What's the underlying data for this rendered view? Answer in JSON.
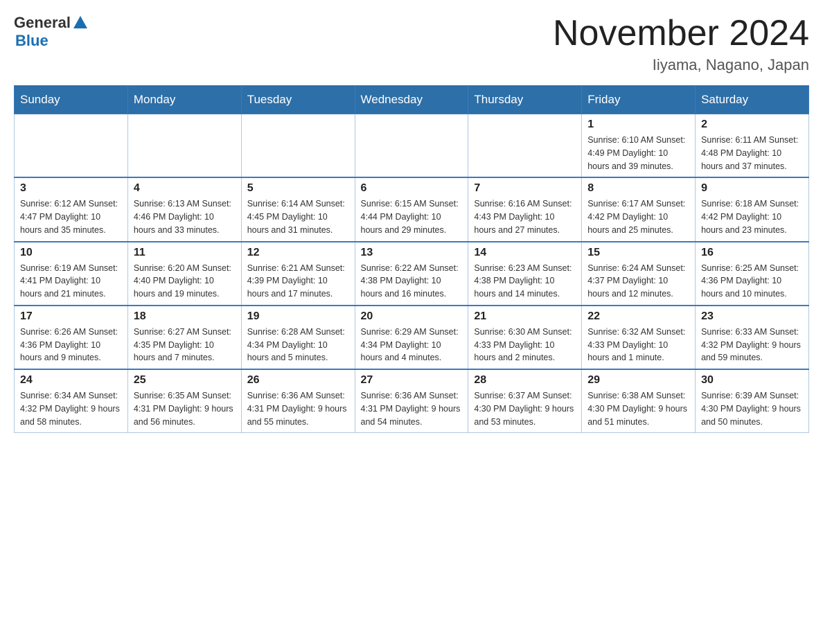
{
  "header": {
    "logo_general": "General",
    "logo_blue": "Blue",
    "month_title": "November 2024",
    "location": "Iiyama, Nagano, Japan"
  },
  "days_of_week": [
    "Sunday",
    "Monday",
    "Tuesday",
    "Wednesday",
    "Thursday",
    "Friday",
    "Saturday"
  ],
  "weeks": [
    [
      {
        "day": "",
        "info": ""
      },
      {
        "day": "",
        "info": ""
      },
      {
        "day": "",
        "info": ""
      },
      {
        "day": "",
        "info": ""
      },
      {
        "day": "",
        "info": ""
      },
      {
        "day": "1",
        "info": "Sunrise: 6:10 AM\nSunset: 4:49 PM\nDaylight: 10 hours and 39 minutes."
      },
      {
        "day": "2",
        "info": "Sunrise: 6:11 AM\nSunset: 4:48 PM\nDaylight: 10 hours and 37 minutes."
      }
    ],
    [
      {
        "day": "3",
        "info": "Sunrise: 6:12 AM\nSunset: 4:47 PM\nDaylight: 10 hours and 35 minutes."
      },
      {
        "day": "4",
        "info": "Sunrise: 6:13 AM\nSunset: 4:46 PM\nDaylight: 10 hours and 33 minutes."
      },
      {
        "day": "5",
        "info": "Sunrise: 6:14 AM\nSunset: 4:45 PM\nDaylight: 10 hours and 31 minutes."
      },
      {
        "day": "6",
        "info": "Sunrise: 6:15 AM\nSunset: 4:44 PM\nDaylight: 10 hours and 29 minutes."
      },
      {
        "day": "7",
        "info": "Sunrise: 6:16 AM\nSunset: 4:43 PM\nDaylight: 10 hours and 27 minutes."
      },
      {
        "day": "8",
        "info": "Sunrise: 6:17 AM\nSunset: 4:42 PM\nDaylight: 10 hours and 25 minutes."
      },
      {
        "day": "9",
        "info": "Sunrise: 6:18 AM\nSunset: 4:42 PM\nDaylight: 10 hours and 23 minutes."
      }
    ],
    [
      {
        "day": "10",
        "info": "Sunrise: 6:19 AM\nSunset: 4:41 PM\nDaylight: 10 hours and 21 minutes."
      },
      {
        "day": "11",
        "info": "Sunrise: 6:20 AM\nSunset: 4:40 PM\nDaylight: 10 hours and 19 minutes."
      },
      {
        "day": "12",
        "info": "Sunrise: 6:21 AM\nSunset: 4:39 PM\nDaylight: 10 hours and 17 minutes."
      },
      {
        "day": "13",
        "info": "Sunrise: 6:22 AM\nSunset: 4:38 PM\nDaylight: 10 hours and 16 minutes."
      },
      {
        "day": "14",
        "info": "Sunrise: 6:23 AM\nSunset: 4:38 PM\nDaylight: 10 hours and 14 minutes."
      },
      {
        "day": "15",
        "info": "Sunrise: 6:24 AM\nSunset: 4:37 PM\nDaylight: 10 hours and 12 minutes."
      },
      {
        "day": "16",
        "info": "Sunrise: 6:25 AM\nSunset: 4:36 PM\nDaylight: 10 hours and 10 minutes."
      }
    ],
    [
      {
        "day": "17",
        "info": "Sunrise: 6:26 AM\nSunset: 4:36 PM\nDaylight: 10 hours and 9 minutes."
      },
      {
        "day": "18",
        "info": "Sunrise: 6:27 AM\nSunset: 4:35 PM\nDaylight: 10 hours and 7 minutes."
      },
      {
        "day": "19",
        "info": "Sunrise: 6:28 AM\nSunset: 4:34 PM\nDaylight: 10 hours and 5 minutes."
      },
      {
        "day": "20",
        "info": "Sunrise: 6:29 AM\nSunset: 4:34 PM\nDaylight: 10 hours and 4 minutes."
      },
      {
        "day": "21",
        "info": "Sunrise: 6:30 AM\nSunset: 4:33 PM\nDaylight: 10 hours and 2 minutes."
      },
      {
        "day": "22",
        "info": "Sunrise: 6:32 AM\nSunset: 4:33 PM\nDaylight: 10 hours and 1 minute."
      },
      {
        "day": "23",
        "info": "Sunrise: 6:33 AM\nSunset: 4:32 PM\nDaylight: 9 hours and 59 minutes."
      }
    ],
    [
      {
        "day": "24",
        "info": "Sunrise: 6:34 AM\nSunset: 4:32 PM\nDaylight: 9 hours and 58 minutes."
      },
      {
        "day": "25",
        "info": "Sunrise: 6:35 AM\nSunset: 4:31 PM\nDaylight: 9 hours and 56 minutes."
      },
      {
        "day": "26",
        "info": "Sunrise: 6:36 AM\nSunset: 4:31 PM\nDaylight: 9 hours and 55 minutes."
      },
      {
        "day": "27",
        "info": "Sunrise: 6:36 AM\nSunset: 4:31 PM\nDaylight: 9 hours and 54 minutes."
      },
      {
        "day": "28",
        "info": "Sunrise: 6:37 AM\nSunset: 4:30 PM\nDaylight: 9 hours and 53 minutes."
      },
      {
        "day": "29",
        "info": "Sunrise: 6:38 AM\nSunset: 4:30 PM\nDaylight: 9 hours and 51 minutes."
      },
      {
        "day": "30",
        "info": "Sunrise: 6:39 AM\nSunset: 4:30 PM\nDaylight: 9 hours and 50 minutes."
      }
    ]
  ]
}
